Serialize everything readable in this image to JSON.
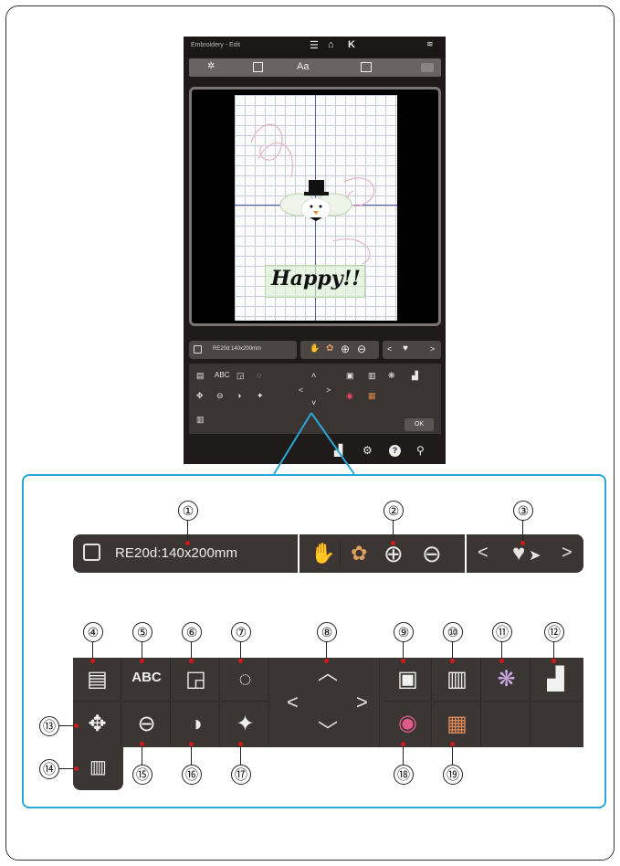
{
  "device": {
    "title": "Embroidery - Edit",
    "infobar_label": "RE20d:140x200mm",
    "design_text": "Happy!!",
    "ok_label": "OK"
  },
  "detail": {
    "hoop_label": "RE20d:140x200mm"
  },
  "callouts": [
    "①",
    "②",
    "③",
    "④",
    "⑤",
    "⑥",
    "⑦",
    "⑧",
    "⑨",
    "⑩",
    "⑪",
    "⑫",
    "⑬",
    "⑭",
    "⑮",
    "⑯",
    "⑰",
    "⑱",
    "⑲"
  ],
  "icons": {
    "menu": "☰",
    "home": "⌂",
    "close": "K",
    "wifi": "≋",
    "pattern": "✲",
    "zoom_in": "⊕",
    "zoom_out": "⊖",
    "left": "〈",
    "right": "〉",
    "up": "︿",
    "down": "﹀",
    "duplicate": "▤",
    "trash": "🗑",
    "color": "◉",
    "settings": "⚙",
    "help": "?",
    "wrench": "⚲"
  },
  "colors": {
    "accent": "#29a8d8",
    "panel": "#3b3533",
    "marker": "#d21919"
  }
}
